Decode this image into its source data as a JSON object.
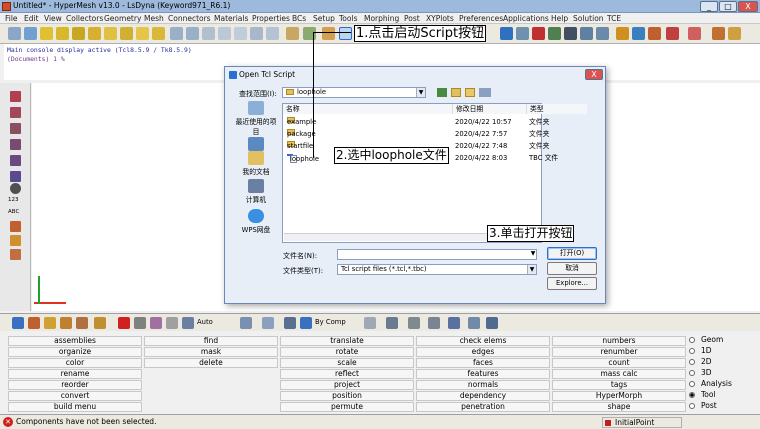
{
  "window": {
    "title": "Untitled* - HyperMesh v13.0 - LsDyna (Keyword971_R6.1)",
    "buttons": [
      "_",
      "□",
      "X"
    ]
  },
  "menu": [
    "File",
    "Edit",
    "View",
    "Collectors",
    "Geometry",
    "Mesh",
    "Connectors",
    "Materials",
    "Properties",
    "BCs",
    "Setup",
    "Tools",
    "Morphing",
    "Post",
    "XYPlots",
    "Preferences",
    "Applications",
    "Help",
    "Solution",
    "TCE"
  ],
  "console": {
    "line1": "Main console display active (Tcl8.5.9 / Tk8.5.9)",
    "line2": "(Documents) 1 %"
  },
  "lefttool": {
    "label1": "123",
    "label2": "ABC"
  },
  "bottom_toolbar": {
    "auto": "Auto",
    "by_comp": "By Comp"
  },
  "dialog": {
    "title": "Open Tcl Script",
    "look_in_label": "查找范围(I):",
    "look_in_value": "loophole",
    "places": [
      "最近使用的项目",
      "桌面",
      "我的文档",
      "计算机",
      "WPS网盘"
    ],
    "columns": [
      "名称",
      "修改日期",
      "类型"
    ],
    "files": [
      {
        "name": "example",
        "date": "2020/4/22 10:57",
        "type": "文件夹",
        "kind": "folder"
      },
      {
        "name": "package",
        "date": "2020/4/22 7:57",
        "type": "文件夹",
        "kind": "folder"
      },
      {
        "name": "startfile",
        "date": "2020/4/22 7:48",
        "type": "文件夹",
        "kind": "folder"
      },
      {
        "name": "loophole",
        "date": "2020/4/22 8:03",
        "type": "TBC 文件",
        "kind": "tbc"
      }
    ],
    "filename_label": "文件名(N):",
    "filename_value": "",
    "filetype_label": "文件类型(T):",
    "filetype_value": "Tcl script files (*.tcl,*.tbc)",
    "open_btn": "打开(O)",
    "cancel_btn": "取消",
    "explore_btn": "Explore..."
  },
  "annotations": {
    "a1": "1.点击启动Script按钮",
    "a2": "2.选中loophole文件",
    "a3": "3.单击打开按钮"
  },
  "panels": {
    "col1": [
      "assemblies",
      "organize",
      "color",
      "rename",
      "reorder",
      "convert",
      "build menu"
    ],
    "col2": [
      "find",
      "mask",
      "delete"
    ],
    "col3": [
      "translate",
      "rotate",
      "scale",
      "reflect",
      "project",
      "position",
      "permute"
    ],
    "col4": [
      "check elems",
      "edges",
      "faces",
      "features",
      "normals",
      "dependency",
      "penetration"
    ],
    "col5": [
      "numbers",
      "renumber",
      "count",
      "mass calc",
      "tags",
      "HyperMorph",
      "shape"
    ],
    "radios": [
      "Geom",
      "1D",
      "2D",
      "3D",
      "Analysis",
      "Tool",
      "Post"
    ],
    "radio_selected": "Tool"
  },
  "status": {
    "message": "Components have not been selected.",
    "loadstep": "InitialPoint"
  },
  "colors": {
    "titlebar": "#9db9dc",
    "dialog_bg": "#e7eef8",
    "accent": "#2a6ed4"
  }
}
